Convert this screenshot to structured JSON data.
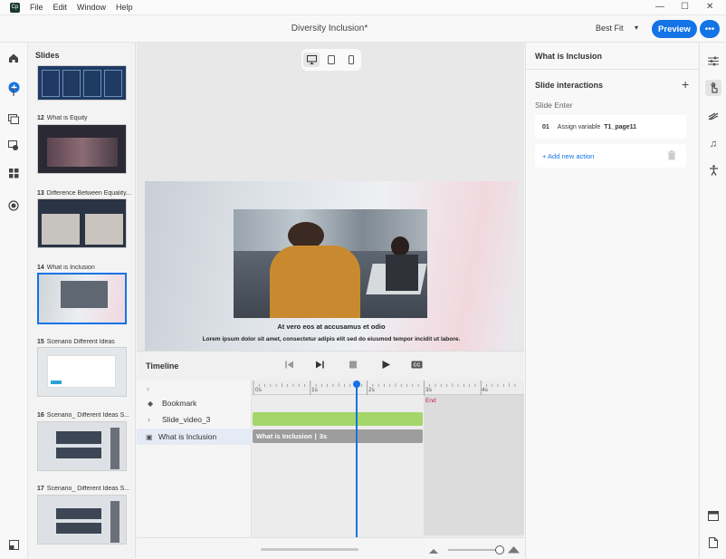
{
  "menu": [
    "File",
    "Edit",
    "Window",
    "Help"
  ],
  "window_controls": {
    "minimize": "—",
    "maximize": "☐",
    "close": "✕"
  },
  "header": {
    "doc_title": "Diversity Inclusion*",
    "fit_label": "Best Fit",
    "preview_label": "Preview",
    "more_label": "•••"
  },
  "slides_panel": {
    "title": "Slides",
    "slides": [
      {
        "num": "",
        "title": ""
      },
      {
        "num": "12",
        "title": "What is Equity"
      },
      {
        "num": "13",
        "title": "Difference Between Equality..."
      },
      {
        "num": "14",
        "title": "What is Inclusion"
      },
      {
        "num": "15",
        "title": "Scenario Different Ideas"
      },
      {
        "num": "16",
        "title": "Scenario_ Different Ideas S..."
      },
      {
        "num": "17",
        "title": "Scenario_ Different Ideas S..."
      }
    ],
    "selected_slide": "14"
  },
  "slide": {
    "heading": "At vero eos at accusamus et odio",
    "body": "Lorem ipsum dolor sit amet, consectetur adipis elit sed do eiusmod tempor incidit ut labore."
  },
  "timeline": {
    "title": "Timeline",
    "rows": [
      {
        "icon": "◆",
        "label": "Bookmark"
      },
      {
        "icon": "›",
        "label": "Slide_video_3"
      },
      {
        "icon": "▣",
        "label": "What is Inclusion"
      }
    ],
    "ticks": [
      "0s",
      "1s",
      "2s",
      "3s",
      "4s"
    ],
    "end_label": "End",
    "slide_bar_label": "What is Inclusion",
    "slide_bar_duration": "3s",
    "playhead_seconds": 1.8
  },
  "right_panel": {
    "title": "What is Inclusion",
    "interactions_title": "Slide interactions",
    "event_label": "Slide Enter",
    "action": {
      "index": "01",
      "text": "Assign variable",
      "variable": "T1_page11"
    },
    "add_action_label": "+ Add new action"
  },
  "colors": {
    "accent": "#1473e6",
    "video_bar": "#a4d66a",
    "slide_bar": "#9d9d9d",
    "end_label": "#c2185b"
  }
}
